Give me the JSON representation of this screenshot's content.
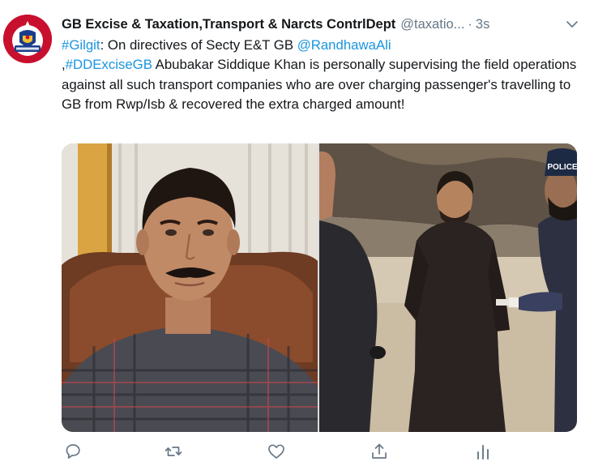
{
  "tweet": {
    "display_name": "GB Excise & Taxation,Transport & Narcts ContrlDept",
    "handle": "@taxatio...",
    "separator": "·",
    "time": "3s",
    "text": {
      "hashtag_gilgit": "#Gilgit",
      "part1": ": On directives of Secty E&T GB ",
      "mention": "@RandhawaAli",
      "part2": ",",
      "hashtag_dd": "#DDExciseGB",
      "part3": " Abubakar Siddique Khan is personally supervising the field operations against all such transport companies who are over charging passenger's travelling to GB from Rwp/Isb & recovered the extra charged amount!"
    },
    "photo_right_sign": "POLICE"
  },
  "avatar": {
    "emblem_text": "EXCISE & TAXATION"
  },
  "icons": {
    "caret": "chevron-down-icon",
    "reply": "reply-icon",
    "retweet": "retweet-icon",
    "like": "heart-icon",
    "share": "share-icon",
    "analytics": "analytics-icon"
  },
  "colors": {
    "link": "#1b95e0",
    "icon_gray": "#657786",
    "avatar_red": "#c8102e"
  }
}
